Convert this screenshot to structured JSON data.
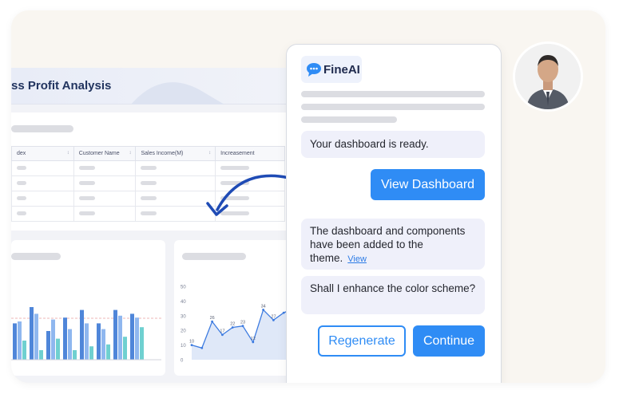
{
  "dashboard": {
    "title": "ss Profit Analysis",
    "table": {
      "columns": [
        "dex",
        "Customer Name",
        "Sales Income(M)",
        "Increasement"
      ],
      "sort_icon": "↕"
    }
  },
  "chat": {
    "logo_text": "FineAI",
    "messages": {
      "ready": "Your dashboard is ready.",
      "added": "The dashboard and components have been added to the theme.",
      "added_link": "View",
      "enhance": "Shall I enhance the color scheme?"
    },
    "buttons": {
      "view_dashboard": "View Dashboard",
      "regenerate": "Regenerate",
      "continue": "Continue"
    }
  },
  "chart_data": [
    {
      "type": "bar",
      "categories": [
        "",
        "",
        "",
        "",
        "",
        "",
        "",
        ""
      ],
      "series": [
        {
          "values": [
            38,
            55,
            30,
            44,
            52,
            38,
            52,
            48
          ]
        },
        {
          "values": [
            40,
            48,
            42,
            32,
            38,
            32,
            46,
            44
          ]
        },
        {
          "values": [
            20,
            10,
            22,
            10,
            14,
            16,
            24,
            34
          ]
        }
      ],
      "colors": [
        "#4f86d9",
        "#8fb7ef",
        "#6fd0d0"
      ]
    },
    {
      "type": "line",
      "x": [
        1,
        2,
        3,
        4,
        5,
        6,
        7,
        8,
        9,
        10,
        11
      ],
      "values": [
        10,
        8,
        26,
        17,
        22,
        23,
        12,
        34,
        27,
        32,
        35
      ],
      "point_labels": [
        "10",
        "",
        "26",
        "17",
        "22",
        "23",
        "12",
        "34",
        "27",
        "",
        ""
      ],
      "yticks": [
        "50",
        "40",
        "30",
        "20",
        "10",
        "0"
      ],
      "ylim": [
        0,
        50
      ]
    }
  ],
  "colors": {
    "accent": "#2f8cf5",
    "title": "#22345f",
    "bubble": "#eff0fa"
  }
}
